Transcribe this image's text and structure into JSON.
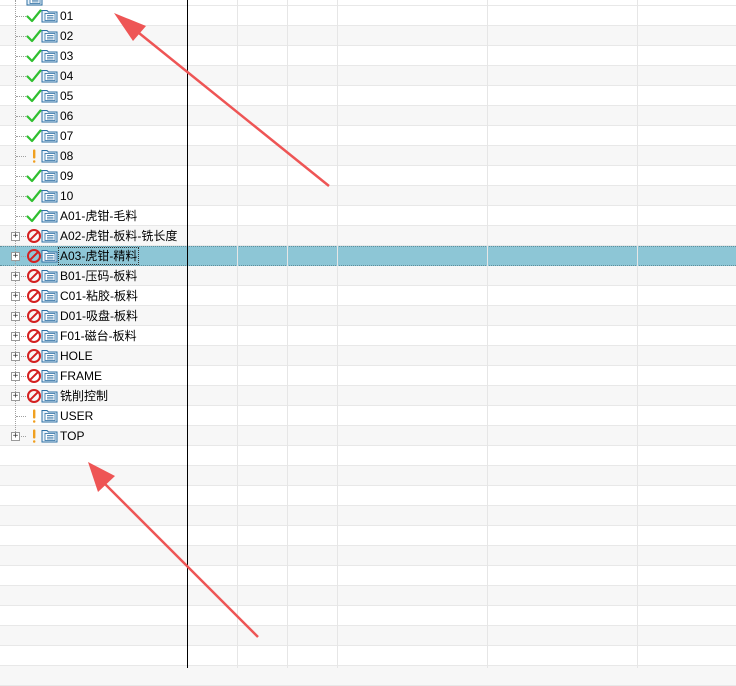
{
  "tree": {
    "items": [
      {
        "label": "01",
        "status": "ok",
        "expandable": false
      },
      {
        "label": "02",
        "status": "ok",
        "expandable": false
      },
      {
        "label": "03",
        "status": "ok",
        "expandable": false
      },
      {
        "label": "04",
        "status": "ok",
        "expandable": false
      },
      {
        "label": "05",
        "status": "ok",
        "expandable": false
      },
      {
        "label": "06",
        "status": "ok",
        "expandable": false
      },
      {
        "label": "07",
        "status": "ok",
        "expandable": false
      },
      {
        "label": "08",
        "status": "warning",
        "expandable": false
      },
      {
        "label": "09",
        "status": "ok",
        "expandable": false
      },
      {
        "label": "10",
        "status": "ok",
        "expandable": false
      },
      {
        "label": "A01-虎钳-毛料",
        "status": "ok",
        "expandable": false
      },
      {
        "label": "A02-虎钳-板料-铣长度",
        "status": "error",
        "expandable": true
      },
      {
        "label": "A03-虎钳-精料",
        "status": "error",
        "expandable": true,
        "selected": true
      },
      {
        "label": "B01-压码-板料",
        "status": "error",
        "expandable": true
      },
      {
        "label": "C01-粘胶-板料",
        "status": "error",
        "expandable": true
      },
      {
        "label": "D01-吸盘-板料",
        "status": "error",
        "expandable": true
      },
      {
        "label": "F01-磁台-板料",
        "status": "error",
        "expandable": true
      },
      {
        "label": "HOLE",
        "status": "error",
        "expandable": true
      },
      {
        "label": "FRAME",
        "status": "error",
        "expandable": true
      },
      {
        "label": "铣削控制",
        "status": "error",
        "expandable": true
      },
      {
        "label": "USER",
        "status": "warning",
        "expandable": false
      },
      {
        "label": "TOP",
        "status": "warning",
        "expandable": true
      }
    ]
  },
  "icons": {
    "ok": "check-icon",
    "warning": "exclamation-icon",
    "error": "prohibited-icon",
    "folder": "program-folder-icon",
    "expand": "plus-expander-icon"
  },
  "colors": {
    "selection": "#8dc6d6",
    "ok": "#2fbf2f",
    "warning": "#f0a020",
    "error": "#d42020",
    "annotation_arrow": "#ee5555"
  },
  "annotations": [
    {
      "name": "annotation-arrow-top",
      "points_to": "tree top"
    },
    {
      "name": "annotation-arrow-bottom",
      "points_to": "tree bottom"
    }
  ]
}
